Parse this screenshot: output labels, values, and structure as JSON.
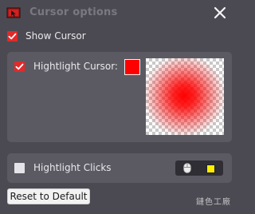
{
  "window": {
    "title": "Cursor options",
    "app_icon": "cursor-app-icon",
    "close_icon": "close-icon"
  },
  "show_cursor": {
    "label": "Show Cursor",
    "checked": true
  },
  "highlight_cursor": {
    "label": "Hightlight Cursor:",
    "checked": true,
    "color": "#ff0000"
  },
  "highlight_clicks": {
    "label": "Hightlight Clicks",
    "checked": false,
    "mouse_icon": "mouse-icon",
    "click_color": "#ffee00"
  },
  "reset_button": {
    "label": "Reset to Default"
  },
  "watermark": {
    "text": "鏈色工廠"
  },
  "colors": {
    "accent": "#e12a2a",
    "window_bg": "#4b4a52",
    "panel_bg": "#5b5a63"
  }
}
